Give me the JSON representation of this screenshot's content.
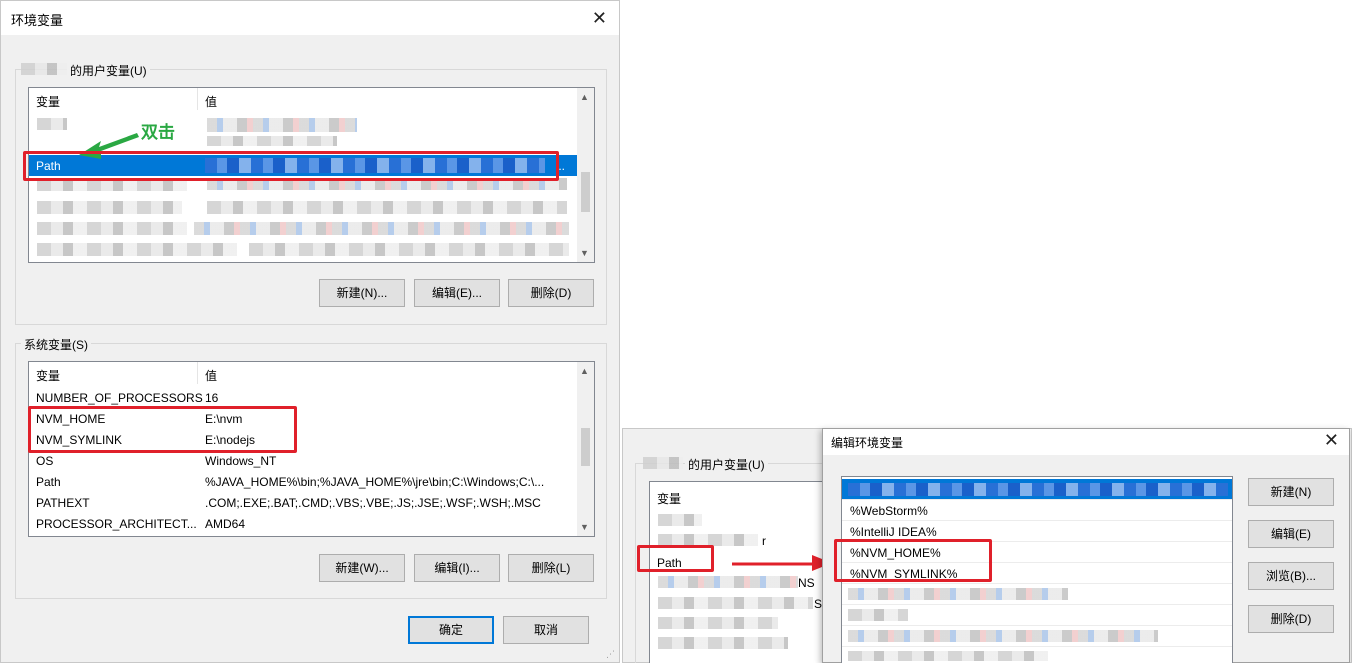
{
  "env_dialog": {
    "title": "环境变量",
    "user_group_label": "的用户变量(U)",
    "user_list": {
      "col_var": "变量",
      "col_val": "值",
      "rows": [
        {
          "var": "Path",
          "val": "..."
        }
      ]
    },
    "annotation": "双击",
    "user_buttons": {
      "new": "新建(N)...",
      "edit": "编辑(E)...",
      "delete": "删除(D)"
    },
    "sys_group_label": "系统变量(S)",
    "sys_list": {
      "col_var": "变量",
      "col_val": "值",
      "rows": [
        {
          "var": "NUMBER_OF_PROCESSORS",
          "val": "16"
        },
        {
          "var": "NVM_HOME",
          "val": "E:\\nvm"
        },
        {
          "var": "NVM_SYMLINK",
          "val": "E:\\nodejs"
        },
        {
          "var": "OS",
          "val": "Windows_NT"
        },
        {
          "var": "Path",
          "val": "%JAVA_HOME%\\bin;%JAVA_HOME%\\jre\\bin;C:\\Windows;C:\\..."
        },
        {
          "var": "PATHEXT",
          "val": ".COM;.EXE;.BAT;.CMD;.VBS;.VBE;.JS;.JSE;.WSF;.WSH;.MSC"
        },
        {
          "var": "PROCESSOR_ARCHITECT...",
          "val": "AMD64"
        }
      ]
    },
    "sys_buttons": {
      "new": "新建(W)...",
      "edit": "编辑(I)...",
      "delete": "删除(L)"
    },
    "ok": "确定",
    "cancel": "取消"
  },
  "bg_dialog": {
    "user_group_label": "的用户变量(U)",
    "col_var": "变量",
    "path_row": "Path",
    "frag_ns": "NS",
    "frag_s": "S",
    "frag_r": "r"
  },
  "edit_dialog": {
    "title": "编辑环境变量",
    "entries": [
      "%WebStorm%",
      "%IntelliJ IDEA%",
      "%NVM_HOME%",
      "%NVM_SYMLINK%"
    ],
    "buttons": {
      "new": "新建(N)",
      "edit": "编辑(E)",
      "browse": "浏览(B)...",
      "delete": "删除(D)"
    }
  },
  "colors": {
    "highlight": "#e0202a",
    "selection": "#0078d7",
    "annotation_arrow": "#2aa843"
  }
}
